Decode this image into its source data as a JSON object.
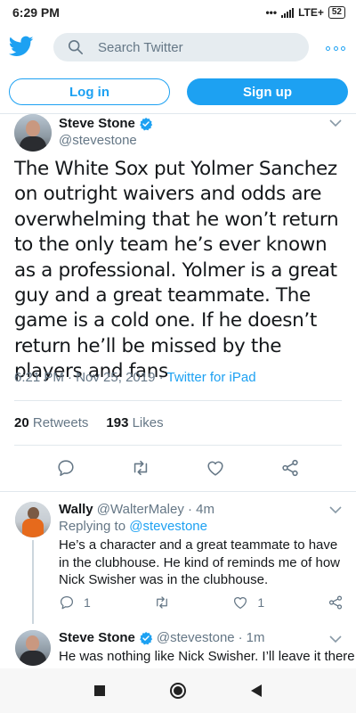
{
  "status_bar": {
    "time": "6:29 PM",
    "network": "LTE+",
    "battery": "52"
  },
  "search": {
    "placeholder": "Search Twitter"
  },
  "auth": {
    "login_label": "Log in",
    "signup_label": "Sign up"
  },
  "tweet": {
    "name": "Steve Stone",
    "handle": "@stevestone",
    "text": "The White Sox put Yolmer Sanchez on outright waivers and odds are overwhelming that he won’t return to the only team he’s ever known as a professional. Yolmer is a great guy and a great teammate. The game is a cold one. If he doesn’t return he’ll be missed by the players and fans",
    "time": "6:21 PM",
    "date": "Nov 25, 2019",
    "source": "Twitter for iPad",
    "retweets_count": "20",
    "retweets_label": "Retweets",
    "likes_count": "193",
    "likes_label": "Likes"
  },
  "replies": [
    {
      "name": "Wally",
      "handle": "@WalterMaley",
      "age": "4m",
      "replying_prefix": "Replying to",
      "replying_to": "@stevestone",
      "text": "He’s a character and a great teammate to have in the clubhouse. He kind of reminds me of how Nick Swisher was in the clubhouse.",
      "reply_count": "1",
      "like_count": "1"
    },
    {
      "name": "Steve Stone",
      "handle": "@stevestone",
      "age": "1m",
      "text": "He was nothing like Nick Swisher. I’ll leave it there"
    }
  ],
  "colors": {
    "accent": "#1da1f2",
    "secondary_text": "#657786",
    "divider": "#e1e8ed"
  }
}
